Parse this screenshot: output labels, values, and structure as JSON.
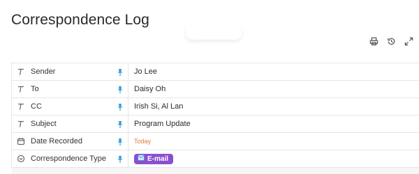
{
  "page": {
    "title": "Correspondence Log"
  },
  "toolbar": {
    "icons": [
      "print-icon",
      "history-icon",
      "expand-icon"
    ]
  },
  "properties": [
    {
      "label": "Sender",
      "type_icon": "text-type-icon",
      "value": "Jo Lee"
    },
    {
      "label": "To",
      "type_icon": "text-type-icon",
      "value": "Daisy Oh"
    },
    {
      "label": "CC",
      "type_icon": "text-type-icon",
      "value": "Irish Si, Al Lan"
    },
    {
      "label": "Subject",
      "type_icon": "text-type-icon",
      "value": "Program Update"
    },
    {
      "label": "Date Recorded",
      "type_icon": "calendar-icon",
      "value": "Today"
    },
    {
      "label": "Correspondence Type",
      "type_icon": "select-type-icon",
      "value": "E-mail",
      "tag_color": "#8a4fd1"
    }
  ],
  "colors": {
    "pin": "#2f9bd8",
    "today": "#e07a3f",
    "tag": "#8a4fd1"
  }
}
